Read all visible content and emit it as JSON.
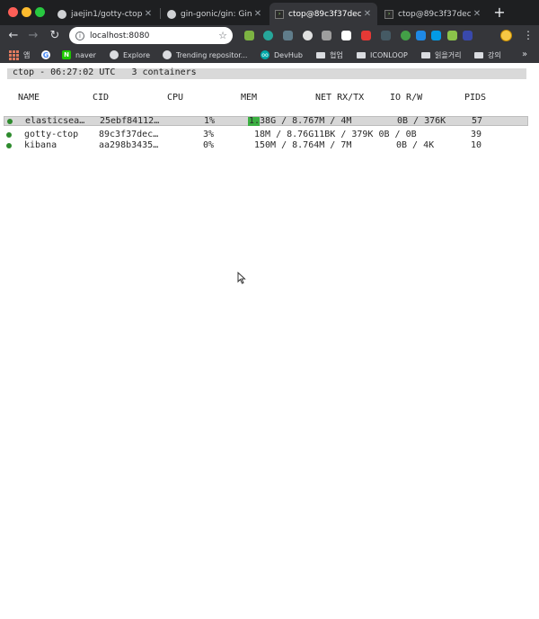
{
  "window": {
    "controls": [
      "close",
      "minimize",
      "zoom"
    ]
  },
  "tabs": [
    {
      "title": "jaejin1/gotty-ctop",
      "active": false,
      "icon": "github-icon"
    },
    {
      "title": "gin-gonic/gin: Gin",
      "active": false,
      "icon": "github-icon"
    },
    {
      "title": "ctop@89c3f37dec",
      "active": true,
      "icon": "terminal-icon"
    },
    {
      "title": "ctop@89c3f37dec",
      "active": false,
      "icon": "terminal-icon"
    }
  ],
  "toolbar": {
    "url": "localhost:8080"
  },
  "bookmarks": [
    {
      "label": "앱",
      "icon": "apps-icon"
    },
    {
      "label": "",
      "icon": "google-icon"
    },
    {
      "label": "naver",
      "icon": "naver-icon"
    },
    {
      "label": "Explore",
      "icon": "github-icon"
    },
    {
      "label": "Trending repositor...",
      "icon": "github-icon"
    },
    {
      "label": "DevHub",
      "icon": "devhub-icon"
    },
    {
      "label": "협업",
      "icon": "folder-icon"
    },
    {
      "label": "ICONLOOP",
      "icon": "folder-icon"
    },
    {
      "label": "읽을거리",
      "icon": "folder-icon"
    },
    {
      "label": "강의",
      "icon": "folder-icon"
    }
  ],
  "ctop": {
    "header": "ctop - 06:27:02 UTC   3 containers",
    "columns": [
      "NAME",
      "CID",
      "CPU",
      "MEM",
      "NET RX/TX",
      "IO R/W",
      "PIDS"
    ],
    "containers": [
      {
        "name": "elasticsea…",
        "cid": "25ebf84112…",
        "cpu": "1%",
        "mem": "1.38G / 8.767M / 4M",
        "io": "0B / 376K",
        "pids": "57",
        "status_color": "#2e8b2e",
        "mem_fraction": 0.16,
        "selected": true
      },
      {
        "name": "gotty-ctop",
        "cid": "89c3f37dec…",
        "cpu": "3%",
        "mem": "18M / 8.76G11BK / 379K 0B / 0B",
        "io": "",
        "pids": "39",
        "status_color": "#2e8b2e",
        "mem_fraction": 0.0,
        "selected": false
      },
      {
        "name": "kibana",
        "cid": "aa298b3435…",
        "cpu": "0%",
        "mem": "150M / 8.764M / 7M",
        "io": "0B / 4K",
        "pids": "10",
        "status_color": "#2e8b2e",
        "mem_fraction": 0.0,
        "selected": false
      }
    ],
    "gauge_color": "#3cb043"
  }
}
